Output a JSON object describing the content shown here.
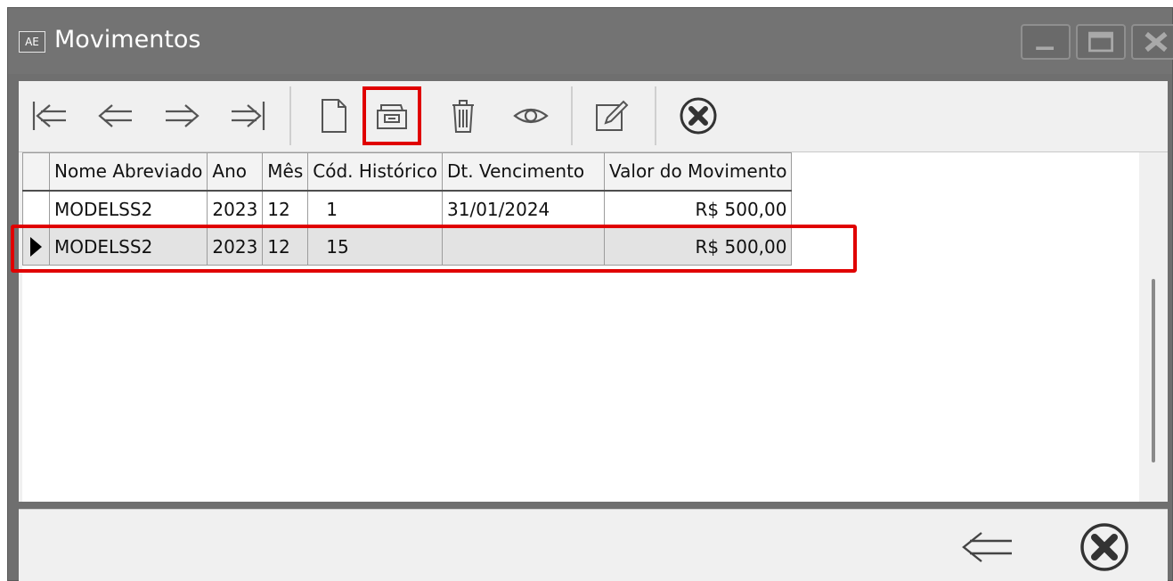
{
  "window": {
    "app_icon_text": "AE",
    "title": "Movimentos",
    "controls": [
      "minimize-icon",
      "maximize-icon",
      "close-icon"
    ]
  },
  "toolbar": {
    "buttons": [
      "first-record-icon",
      "previous-record-icon",
      "next-record-icon",
      "last-record-icon",
      "new-document-icon",
      "open-folder-icon",
      "trash-icon",
      "eye-icon",
      "edit-icon",
      "cancel-icon"
    ],
    "highlighted": "open-folder-icon",
    "highlight_color": "#e00000"
  },
  "grid": {
    "columns": [
      "Nome Abreviado",
      "Ano",
      "Mês",
      "Cód. Histórico",
      "Dt. Vencimento",
      "Valor do Movimento"
    ],
    "rows": [
      {
        "nome": "MODELSS2",
        "ano": "2023",
        "mes": "12",
        "cod": "1",
        "dt": "31/01/2024",
        "valor": "R$ 500,00"
      },
      {
        "nome": "MODELSS2",
        "ano": "2023",
        "mes": "12",
        "cod": "15",
        "dt": "",
        "valor": "R$ 500,00"
      }
    ],
    "selected_row": 1
  },
  "footer": {
    "buttons": [
      "back-arrow-icon",
      "cancel-icon"
    ]
  }
}
